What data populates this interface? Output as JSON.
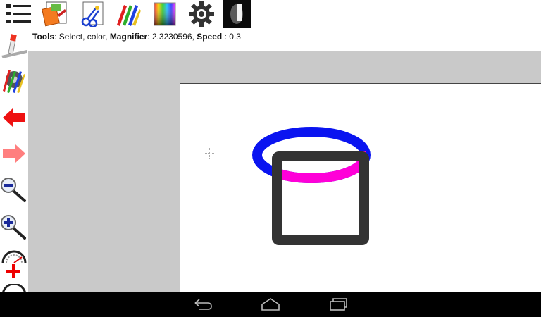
{
  "toolbar": {
    "items": [
      {
        "name": "menu-list-icon"
      },
      {
        "name": "file-open-icon"
      },
      {
        "name": "select-scissors-icon"
      },
      {
        "name": "pencils-icon"
      },
      {
        "name": "color-gradient-icon"
      },
      {
        "name": "settings-gear-icon"
      },
      {
        "name": "brush-preview-icon"
      }
    ]
  },
  "status": {
    "tools_label": "Tools",
    "tools_value": ": Select, color, ",
    "magnifier_label": "Magnifier",
    "magnifier_value": ": 2.3230596, ",
    "speed_label": "Speed",
    "speed_value": " : 0.3"
  },
  "sidebar": {
    "items": [
      {
        "name": "eraser-pencil-icon"
      },
      {
        "name": "pencils-gear-icon"
      },
      {
        "name": "undo-arrow-icon"
      },
      {
        "name": "redo-arrow-icon"
      },
      {
        "name": "zoom-out-icon"
      },
      {
        "name": "zoom-in-icon"
      },
      {
        "name": "speed-gauge-plus-icon"
      },
      {
        "name": "speed-gauge-minus-icon"
      }
    ]
  },
  "colors": {
    "ellipse": "#0a14f0",
    "ellipse_overlap": "#ff00d8",
    "rectangle": "#333333",
    "workspace": "#c9c9c9",
    "navbar": "#000000"
  },
  "navbar": {
    "items": [
      {
        "name": "back-icon"
      },
      {
        "name": "home-icon"
      },
      {
        "name": "recent-apps-icon"
      }
    ]
  }
}
